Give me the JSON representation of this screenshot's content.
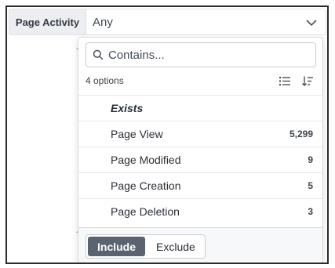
{
  "filter": {
    "label": "Page Activity",
    "value": "Any"
  },
  "background": {
    "stub_1": "´",
    "stub_2": "´"
  },
  "dropdown": {
    "search_placeholder": "Contains...",
    "options_count": "4 options",
    "options": [
      {
        "label": "Exists",
        "count": ""
      },
      {
        "label": "Page View",
        "count": "5,299"
      },
      {
        "label": "Page Modified",
        "count": "9"
      },
      {
        "label": "Page Creation",
        "count": "5"
      },
      {
        "label": "Page Deletion",
        "count": "3"
      }
    ],
    "include_label": "Include",
    "exclude_label": "Exclude"
  }
}
